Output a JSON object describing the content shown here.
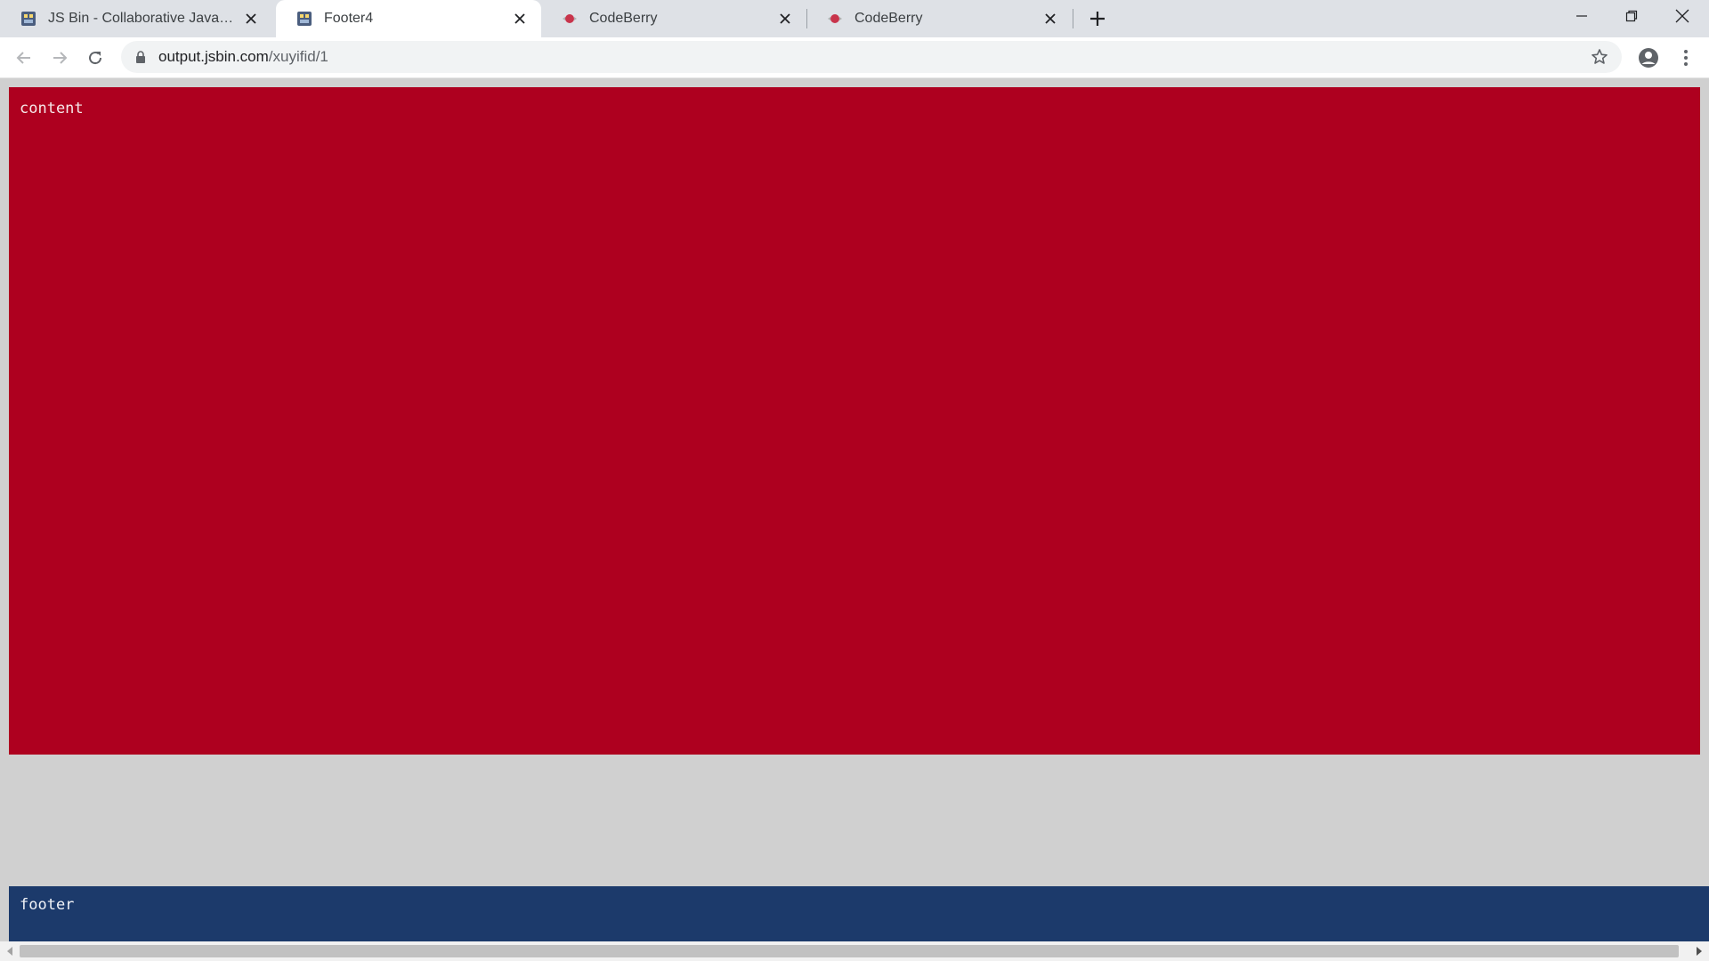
{
  "browser": {
    "tabs": [
      {
        "title": "JS Bin - Collaborative JavaScript Debugging",
        "icon": "jsbin-favicon-icon",
        "active": false
      },
      {
        "title": "Footer4",
        "icon": "jsbin-favicon-icon",
        "active": true
      },
      {
        "title": "CodeBerry",
        "icon": "codeberry-favicon-icon",
        "active": false
      },
      {
        "title": "CodeBerry",
        "icon": "codeberry-favicon-icon",
        "active": false
      }
    ],
    "address": {
      "host": "output.jsbin.com",
      "path": "/xuyifid/1"
    }
  },
  "page": {
    "content_text": "content",
    "footer_text": "footer",
    "colors": {
      "content_bg": "#ae001f",
      "footer_bg": "#1c3a6b",
      "page_bg": "#d0d0d0"
    }
  }
}
